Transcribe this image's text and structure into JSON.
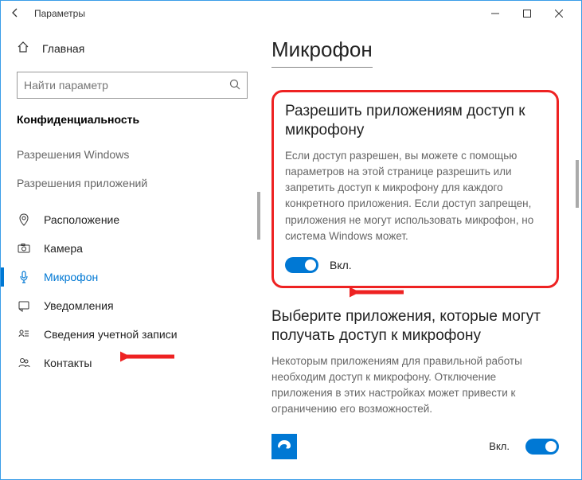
{
  "window": {
    "title": "Параметры"
  },
  "sidebar": {
    "home": "Главная",
    "search_placeholder": "Найти параметр",
    "category": "Конфиденциальность",
    "group1": "Разрешения Windows",
    "group2": "Разрешения приложений",
    "items": [
      {
        "label": "Расположение"
      },
      {
        "label": "Камера"
      },
      {
        "label": "Микрофон"
      },
      {
        "label": "Уведомления"
      },
      {
        "label": "Сведения учетной записи"
      },
      {
        "label": "Контакты"
      }
    ]
  },
  "main": {
    "title": "Микрофон",
    "section1": {
      "title": "Разрешить приложениям доступ к микрофону",
      "desc": "Если доступ разрешен, вы можете с помощью параметров на этой странице разрешить или запретить доступ к микрофону для каждого конкретного приложения. Если доступ запрещен, приложения не могут использовать микрофон, но система Windows может.",
      "toggle_label": "Вкл."
    },
    "section2": {
      "title": "Выберите приложения, которые могут получать доступ к микрофону",
      "desc": "Некоторым приложениям для правильной работы необходим доступ к микрофону. Отключение приложения в этих настройках может привести к ограничению его возможностей.",
      "app_toggle_label": "Вкл."
    }
  }
}
